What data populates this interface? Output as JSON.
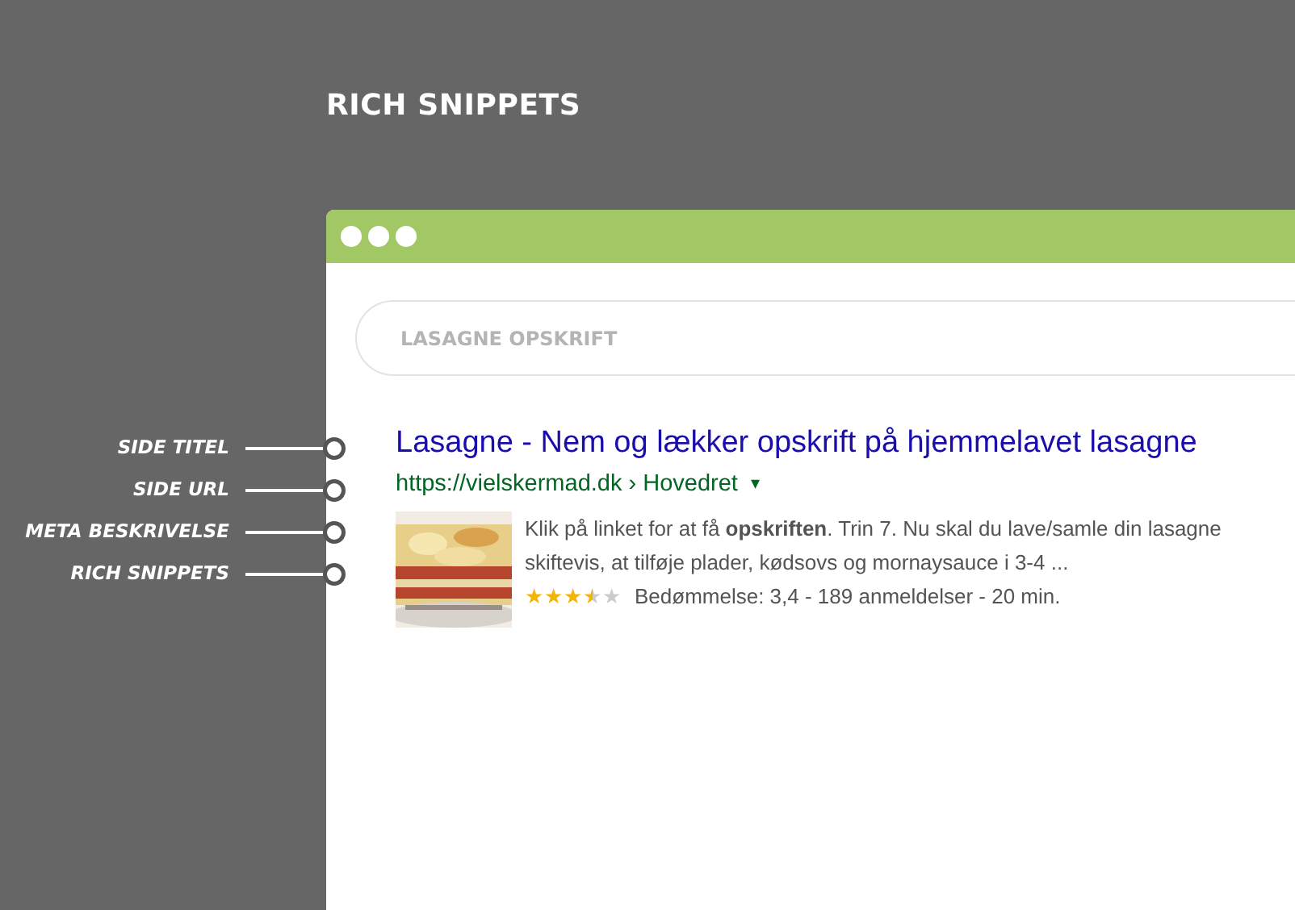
{
  "heading": "RICH SNIPPETS",
  "annotations": [
    {
      "label": "SIDE TITEL"
    },
    {
      "label": "SIDE URL"
    },
    {
      "label": "META BESKRIVELSE"
    },
    {
      "label": "RICH SNIPPETS"
    }
  ],
  "browser": {
    "search": {
      "value": "LASAGNE OPSKRIFT"
    },
    "result": {
      "title": "Lasagne - Nem og lækker opskrift på hjemmelavet lasagne",
      "url": "https://vielskermad.dk › Hovedret",
      "url_caret": "▾",
      "description": [
        "Klik på linket for at få **opskriften**. Trin 7. Nu skal du lave/samle din lasagne",
        "skiftevis, at tilføje plader, kødsovs og mornaysauce i 3-4 ..."
      ],
      "stars": 3.5,
      "rating": "Bedømmelse: 3,4 - 189 anmeldelser - 20 min."
    }
  }
}
